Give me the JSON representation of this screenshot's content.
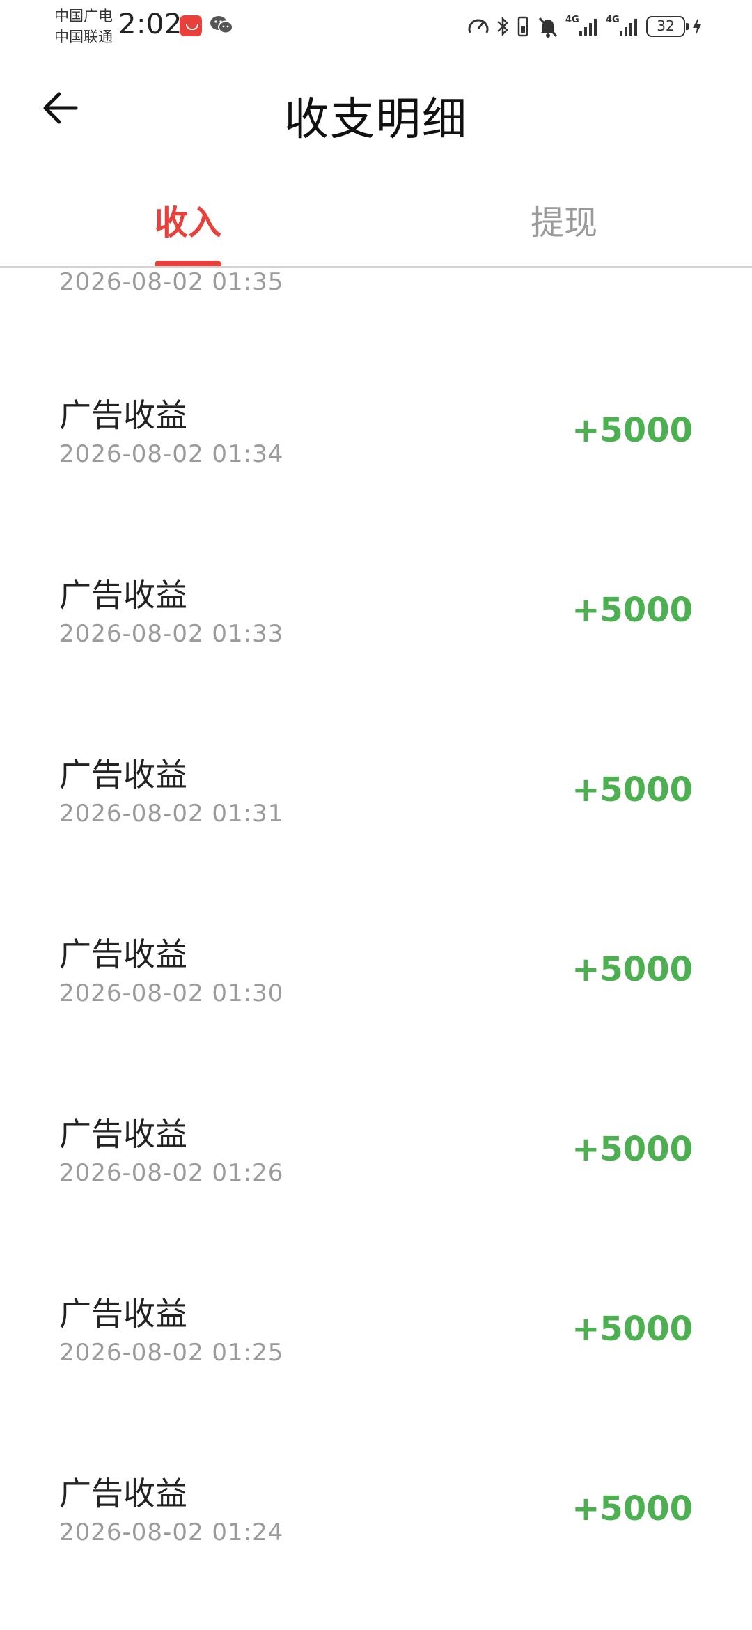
{
  "status_bar": {
    "carrier_1": "中国广电",
    "carrier_2": "中国联通",
    "time": "2:02",
    "network_1": "4G",
    "network_2": "4G",
    "battery": "32"
  },
  "header": {
    "title": "收支明细",
    "back_icon": "arrow-left-icon"
  },
  "tabs": [
    {
      "label": "收入",
      "active": true
    },
    {
      "label": "提现",
      "active": false
    }
  ],
  "accent_color": "#e8413b",
  "amount_color": "#4caf50",
  "list": {
    "partial_top_time": "2026-08-02 01:35",
    "records": [
      {
        "title": "广告收益",
        "time": "2026-08-02 01:34",
        "amount": "+5000"
      },
      {
        "title": "广告收益",
        "time": "2026-08-02 01:33",
        "amount": "+5000"
      },
      {
        "title": "广告收益",
        "time": "2026-08-02 01:31",
        "amount": "+5000"
      },
      {
        "title": "广告收益",
        "time": "2026-08-02 01:30",
        "amount": "+5000"
      },
      {
        "title": "广告收益",
        "time": "2026-08-02 01:26",
        "amount": "+5000"
      },
      {
        "title": "广告收益",
        "time": "2026-08-02 01:25",
        "amount": "+5000"
      },
      {
        "title": "广告收益",
        "time": "2026-08-02 01:24",
        "amount": "+5000"
      }
    ]
  }
}
